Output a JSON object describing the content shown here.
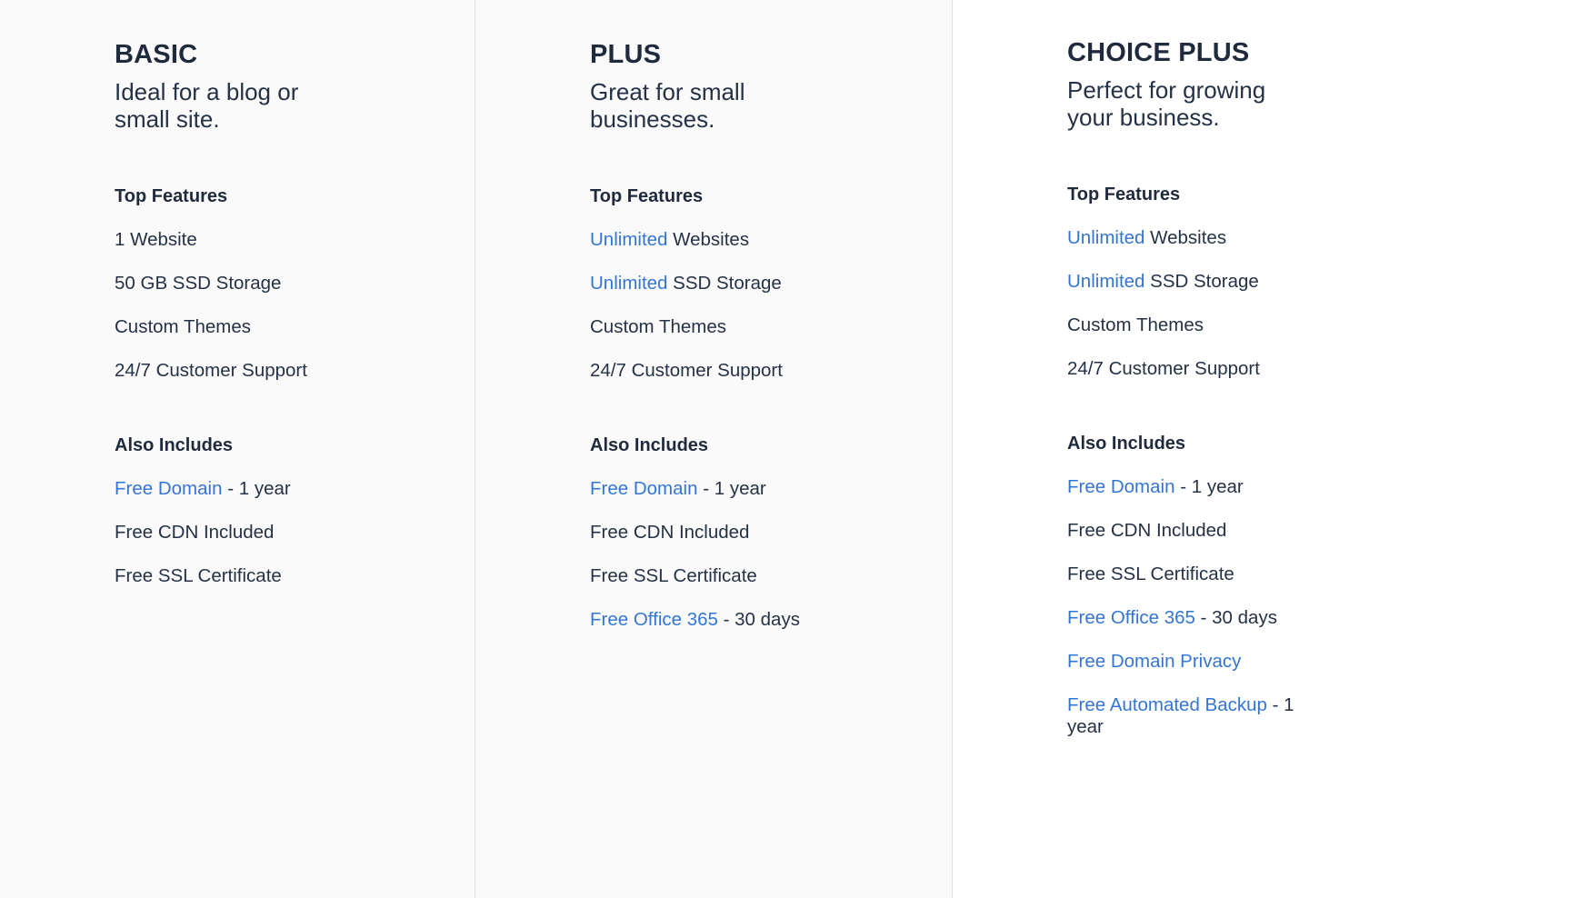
{
  "colors": {
    "text": "#1f2a3c",
    "link": "#3575d3",
    "panel_bg": "#fafafa",
    "highlight_panel_bg": "#ffffff",
    "divider": "#e2e2e2"
  },
  "plans": [
    {
      "title": "BASIC",
      "tagline": "Ideal for a blog or small site.",
      "top_features_label": "Top Features",
      "top_features": [
        {
          "highlight": "",
          "text": "1 Website"
        },
        {
          "highlight": "",
          "text": "50 GB SSD Storage"
        },
        {
          "highlight": "",
          "text": "Custom Themes"
        },
        {
          "highlight": "",
          "text": "24/7 Customer Support"
        }
      ],
      "also_includes_label": "Also Includes",
      "also_includes": [
        {
          "highlight": "Free Domain",
          "text": " - 1 year"
        },
        {
          "highlight": "",
          "text": "Free CDN Included"
        },
        {
          "highlight": "",
          "text": "Free SSL Certificate"
        }
      ]
    },
    {
      "title": "PLUS",
      "tagline": "Great for small businesses.",
      "top_features_label": "Top Features",
      "top_features": [
        {
          "highlight": "Unlimited",
          "text": " Websites"
        },
        {
          "highlight": "Unlimited",
          "text": " SSD Storage"
        },
        {
          "highlight": "",
          "text": "Custom Themes"
        },
        {
          "highlight": "",
          "text": "24/7 Customer Support"
        }
      ],
      "also_includes_label": "Also Includes",
      "also_includes": [
        {
          "highlight": "Free Domain",
          "text": " - 1 year"
        },
        {
          "highlight": "",
          "text": "Free CDN Included"
        },
        {
          "highlight": "",
          "text": "Free SSL Certificate"
        },
        {
          "highlight": "Free Office 365",
          "text": " - 30 days"
        }
      ]
    },
    {
      "title": "CHOICE PLUS",
      "tagline": "Perfect for growing your business.",
      "top_features_label": "Top Features",
      "top_features": [
        {
          "highlight": "Unlimited",
          "text": " Websites"
        },
        {
          "highlight": "Unlimited",
          "text": " SSD Storage"
        },
        {
          "highlight": "",
          "text": "Custom Themes"
        },
        {
          "highlight": "",
          "text": "24/7 Customer Support"
        }
      ],
      "also_includes_label": "Also Includes",
      "also_includes": [
        {
          "highlight": "Free Domain",
          "text": " - 1 year"
        },
        {
          "highlight": "",
          "text": "Free CDN Included"
        },
        {
          "highlight": "",
          "text": "Free SSL Certificate"
        },
        {
          "highlight": "Free Office 365",
          "text": " - 30 days"
        },
        {
          "highlight": "Free Domain Privacy",
          "text": ""
        },
        {
          "highlight": "Free Automated Backup",
          "text": " - 1 year"
        }
      ]
    }
  ]
}
